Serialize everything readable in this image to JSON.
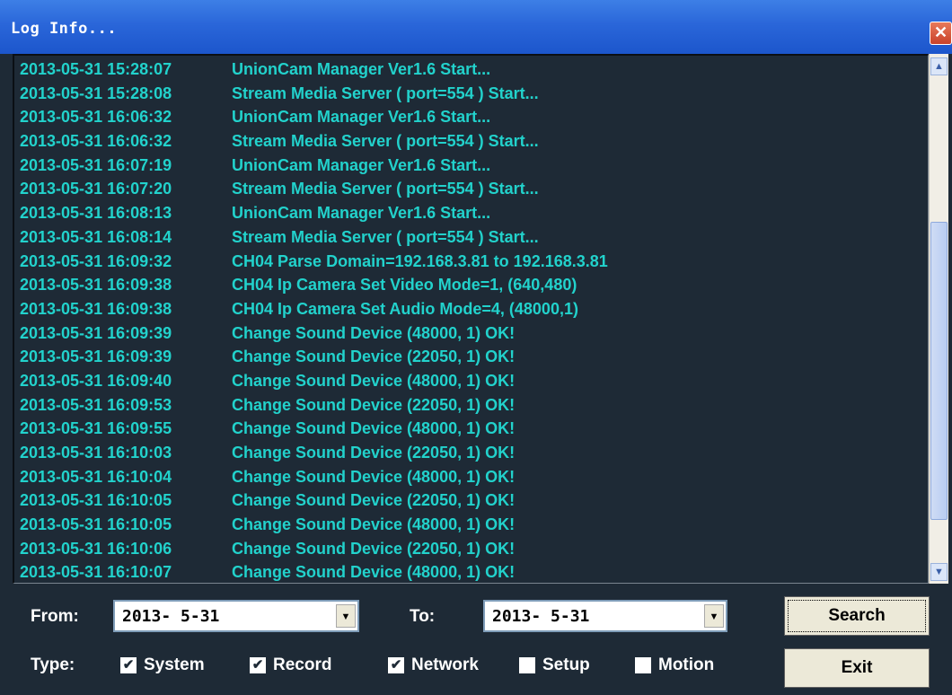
{
  "window": {
    "title": "Log Info...",
    "close_glyph": "✕"
  },
  "log": [
    {
      "ts": "2013-05-31 15:28:07",
      "msg": "UnionCam Manager Ver1.6 Start..."
    },
    {
      "ts": "2013-05-31 15:28:08",
      "msg": "Stream Media Server ( port=554 ) Start..."
    },
    {
      "ts": "2013-05-31 16:06:32",
      "msg": "UnionCam Manager Ver1.6 Start..."
    },
    {
      "ts": "2013-05-31 16:06:32",
      "msg": "Stream Media Server ( port=554 ) Start..."
    },
    {
      "ts": "2013-05-31 16:07:19",
      "msg": "UnionCam Manager Ver1.6 Start..."
    },
    {
      "ts": "2013-05-31 16:07:20",
      "msg": "Stream Media Server ( port=554 ) Start..."
    },
    {
      "ts": "2013-05-31 16:08:13",
      "msg": "UnionCam Manager Ver1.6 Start..."
    },
    {
      "ts": "2013-05-31 16:08:14",
      "msg": "Stream Media Server ( port=554 ) Start..."
    },
    {
      "ts": "2013-05-31 16:09:32",
      "msg": "CH04 Parse Domain=192.168.3.81 to 192.168.3.81"
    },
    {
      "ts": "2013-05-31 16:09:38",
      "msg": "CH04 Ip Camera Set Video Mode=1, (640,480)"
    },
    {
      "ts": "2013-05-31 16:09:38",
      "msg": "CH04 Ip Camera Set Audio Mode=4, (48000,1)"
    },
    {
      "ts": "2013-05-31 16:09:39",
      "msg": "Change Sound Device (48000, 1) OK!"
    },
    {
      "ts": "2013-05-31 16:09:39",
      "msg": "Change Sound Device (22050, 1) OK!"
    },
    {
      "ts": "2013-05-31 16:09:40",
      "msg": "Change Sound Device (48000, 1) OK!"
    },
    {
      "ts": "2013-05-31 16:09:53",
      "msg": "Change Sound Device (22050, 1) OK!"
    },
    {
      "ts": "2013-05-31 16:09:55",
      "msg": "Change Sound Device (48000, 1) OK!"
    },
    {
      "ts": "2013-05-31 16:10:03",
      "msg": "Change Sound Device (22050, 1) OK!"
    },
    {
      "ts": "2013-05-31 16:10:04",
      "msg": "Change Sound Device (48000, 1) OK!"
    },
    {
      "ts": "2013-05-31 16:10:05",
      "msg": "Change Sound Device (22050, 1) OK!"
    },
    {
      "ts": "2013-05-31 16:10:05",
      "msg": "Change Sound Device (48000, 1) OK!"
    },
    {
      "ts": "2013-05-31 16:10:06",
      "msg": "Change Sound Device (22050, 1) OK!"
    },
    {
      "ts": "2013-05-31 16:10:07",
      "msg": "Change Sound Device (48000, 1) OK!"
    }
  ],
  "filters": {
    "from_label": "From:",
    "from_value": "2013- 5-31",
    "to_label": "To:",
    "to_value": "2013- 5-31",
    "type_label": "Type:",
    "types": [
      {
        "label": "System",
        "checked": true
      },
      {
        "label": "Record",
        "checked": true
      },
      {
        "label": "Network",
        "checked": true
      },
      {
        "label": "Setup",
        "checked": false
      },
      {
        "label": "Motion",
        "checked": false
      }
    ]
  },
  "buttons": {
    "search": "Search",
    "exit": "Exit"
  },
  "colors": {
    "log_text": "#22d2cc",
    "background": "#1e2a36",
    "titlebar": "#2a66d9"
  },
  "icons": {
    "check": "✔",
    "dropdown": "▼",
    "scroll_up": "▲",
    "scroll_down": "▼"
  }
}
